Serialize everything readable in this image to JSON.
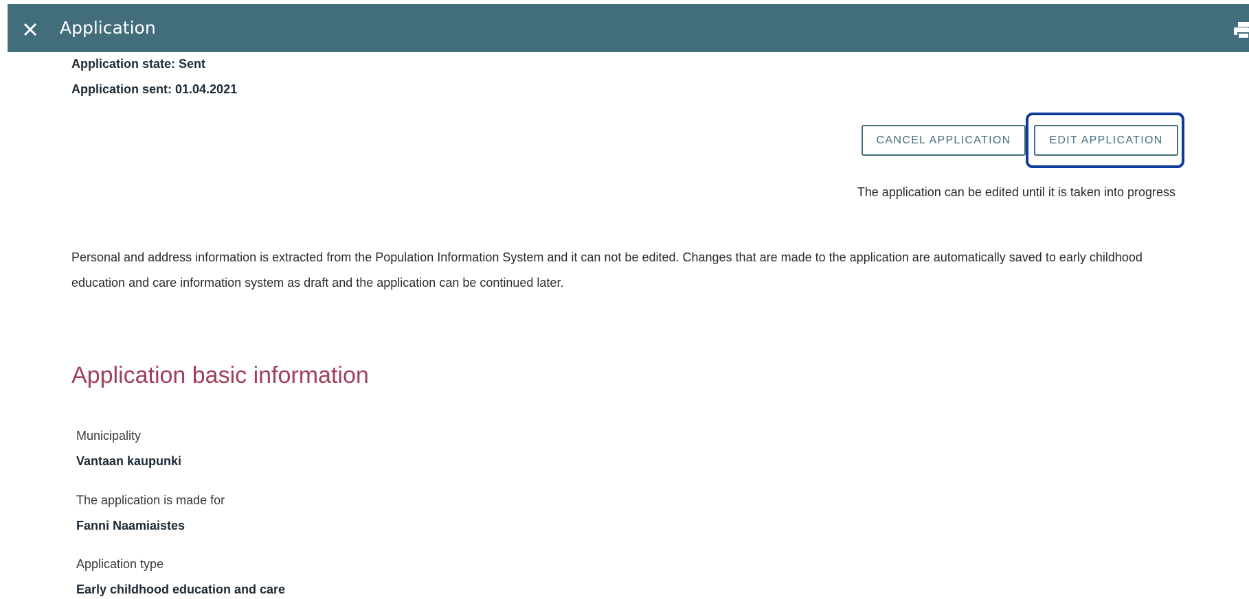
{
  "header": {
    "title": "Application",
    "close_icon": "close-icon",
    "print_icon": "print-icon",
    "bg_color": "#426e7c"
  },
  "status": {
    "state": "Application state: Sent",
    "sent": "Application sent: 01.04.2021"
  },
  "actions": {
    "cancel_label": "CANCEL APPLICATION",
    "edit_label": "EDIT APPLICATION",
    "edit_note": "The application can be edited until it is taken into progress",
    "highlight_color": "#0f3c9a"
  },
  "info_text": "Personal and address information is extracted from the Population Information System and it can not be edited. Changes that are made to the application are automatically saved to early childhood education and care information system as draft and the application can be continued later.",
  "basic_info": {
    "heading": "Application basic information",
    "heading_color": "#a0405a",
    "fields": [
      {
        "label": "Municipality",
        "value": "Vantaan kaupunki"
      },
      {
        "label": "The application is made for",
        "value": "Fanni Naamiaistes"
      },
      {
        "label": "Application type",
        "value": "Early childhood education and care"
      }
    ]
  }
}
